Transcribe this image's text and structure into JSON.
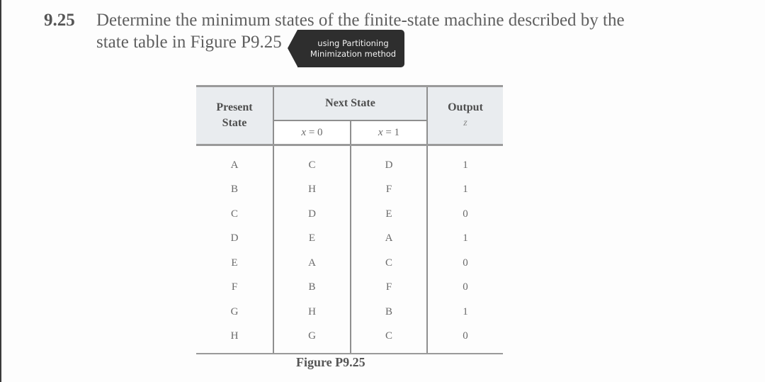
{
  "problem": {
    "number": "9.25",
    "line1": "Determine the minimum states of the finite-state machine described by the",
    "line2": "state table in Figure P9.25"
  },
  "tooltip": {
    "line1": "using Partitioning",
    "line2": "Minimization method",
    "background": "#2e2e2e"
  },
  "table": {
    "headers": {
      "present_line1": "Present",
      "present_line2": "State",
      "next_state": "Next State",
      "x0_var": "x",
      "x0_eq": " = 0",
      "x1_var": "x",
      "x1_eq": " = 1",
      "output": "Output",
      "output_var": "z"
    },
    "rows": [
      {
        "present": "A",
        "x0": "C",
        "x1": "D",
        "z": "1"
      },
      {
        "present": "B",
        "x0": "H",
        "x1": "F",
        "z": "1"
      },
      {
        "present": "C",
        "x0": "D",
        "x1": "E",
        "z": "0"
      },
      {
        "present": "D",
        "x0": "E",
        "x1": "A",
        "z": "1"
      },
      {
        "present": "E",
        "x0": "A",
        "x1": "C",
        "z": "0"
      },
      {
        "present": "F",
        "x0": "B",
        "x1": "F",
        "z": "0"
      },
      {
        "present": "G",
        "x0": "H",
        "x1": "B",
        "z": "1"
      },
      {
        "present": "H",
        "x0": "G",
        "x1": "C",
        "z": "0"
      }
    ],
    "header_background": "#e9ecef"
  },
  "caption": "Figure P9.25"
}
